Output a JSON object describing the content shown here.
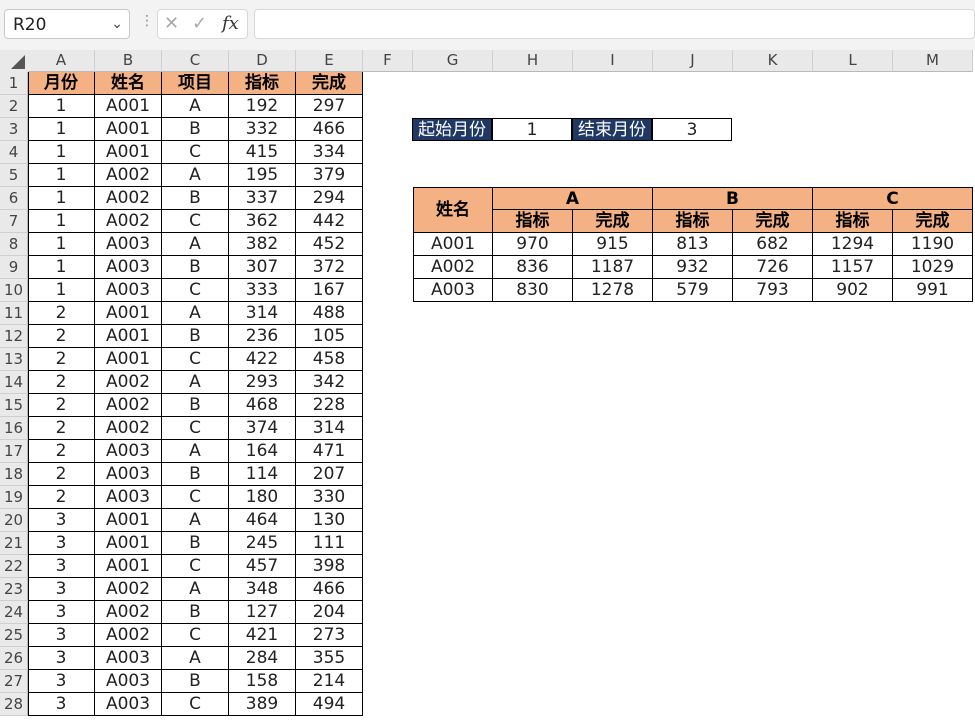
{
  "name_box": {
    "value": "R20"
  },
  "formula_bar": {
    "formula": "",
    "fx_label": "fx"
  },
  "column_headers": [
    "A",
    "B",
    "C",
    "D",
    "E",
    "F",
    "G",
    "H",
    "I",
    "J",
    "K",
    "L",
    "M"
  ],
  "row_headers": [
    "1",
    "2",
    "3",
    "4",
    "5",
    "6",
    "7",
    "8",
    "9",
    "10",
    "11",
    "12",
    "13",
    "14",
    "15",
    "16",
    "17",
    "18",
    "19",
    "20",
    "21",
    "22",
    "23",
    "24",
    "25",
    "26",
    "27",
    "28"
  ],
  "source_table": {
    "headers": [
      "月份",
      "姓名",
      "项目",
      "指标",
      "完成"
    ],
    "rows": [
      [
        "1",
        "A001",
        "A",
        "192",
        "297"
      ],
      [
        "1",
        "A001",
        "B",
        "332",
        "466"
      ],
      [
        "1",
        "A001",
        "C",
        "415",
        "334"
      ],
      [
        "1",
        "A002",
        "A",
        "195",
        "379"
      ],
      [
        "1",
        "A002",
        "B",
        "337",
        "294"
      ],
      [
        "1",
        "A002",
        "C",
        "362",
        "442"
      ],
      [
        "1",
        "A003",
        "A",
        "382",
        "452"
      ],
      [
        "1",
        "A003",
        "B",
        "307",
        "372"
      ],
      [
        "1",
        "A003",
        "C",
        "333",
        "167"
      ],
      [
        "2",
        "A001",
        "A",
        "314",
        "488"
      ],
      [
        "2",
        "A001",
        "B",
        "236",
        "105"
      ],
      [
        "2",
        "A001",
        "C",
        "422",
        "458"
      ],
      [
        "2",
        "A002",
        "A",
        "293",
        "342"
      ],
      [
        "2",
        "A002",
        "B",
        "468",
        "228"
      ],
      [
        "2",
        "A002",
        "C",
        "374",
        "314"
      ],
      [
        "2",
        "A003",
        "A",
        "164",
        "471"
      ],
      [
        "2",
        "A003",
        "B",
        "114",
        "207"
      ],
      [
        "2",
        "A003",
        "C",
        "180",
        "330"
      ],
      [
        "3",
        "A001",
        "A",
        "464",
        "130"
      ],
      [
        "3",
        "A001",
        "B",
        "245",
        "111"
      ],
      [
        "3",
        "A001",
        "C",
        "457",
        "398"
      ],
      [
        "3",
        "A002",
        "A",
        "348",
        "466"
      ],
      [
        "3",
        "A002",
        "B",
        "127",
        "204"
      ],
      [
        "3",
        "A002",
        "C",
        "421",
        "273"
      ],
      [
        "3",
        "A003",
        "A",
        "284",
        "355"
      ],
      [
        "3",
        "A003",
        "B",
        "158",
        "214"
      ],
      [
        "3",
        "A003",
        "C",
        "389",
        "494"
      ]
    ]
  },
  "criteria": {
    "start_label": "起始月份",
    "start_value": "1",
    "end_label": "结束月份",
    "end_value": "3"
  },
  "summary_table": {
    "name_header": "姓名",
    "groups": [
      "A",
      "B",
      "C"
    ],
    "sub_headers": [
      "指标",
      "完成",
      "指标",
      "完成",
      "指标",
      "完成"
    ],
    "rows": [
      [
        "A001",
        "970",
        "915",
        "813",
        "682",
        "1294",
        "1190"
      ],
      [
        "A002",
        "836",
        "1187",
        "932",
        "726",
        "1157",
        "1029"
      ],
      [
        "A003",
        "830",
        "1278",
        "579",
        "793",
        "902",
        "991"
      ]
    ]
  },
  "colors": {
    "header_fill": "#f4b183",
    "label_fill": "#1f3864"
  }
}
